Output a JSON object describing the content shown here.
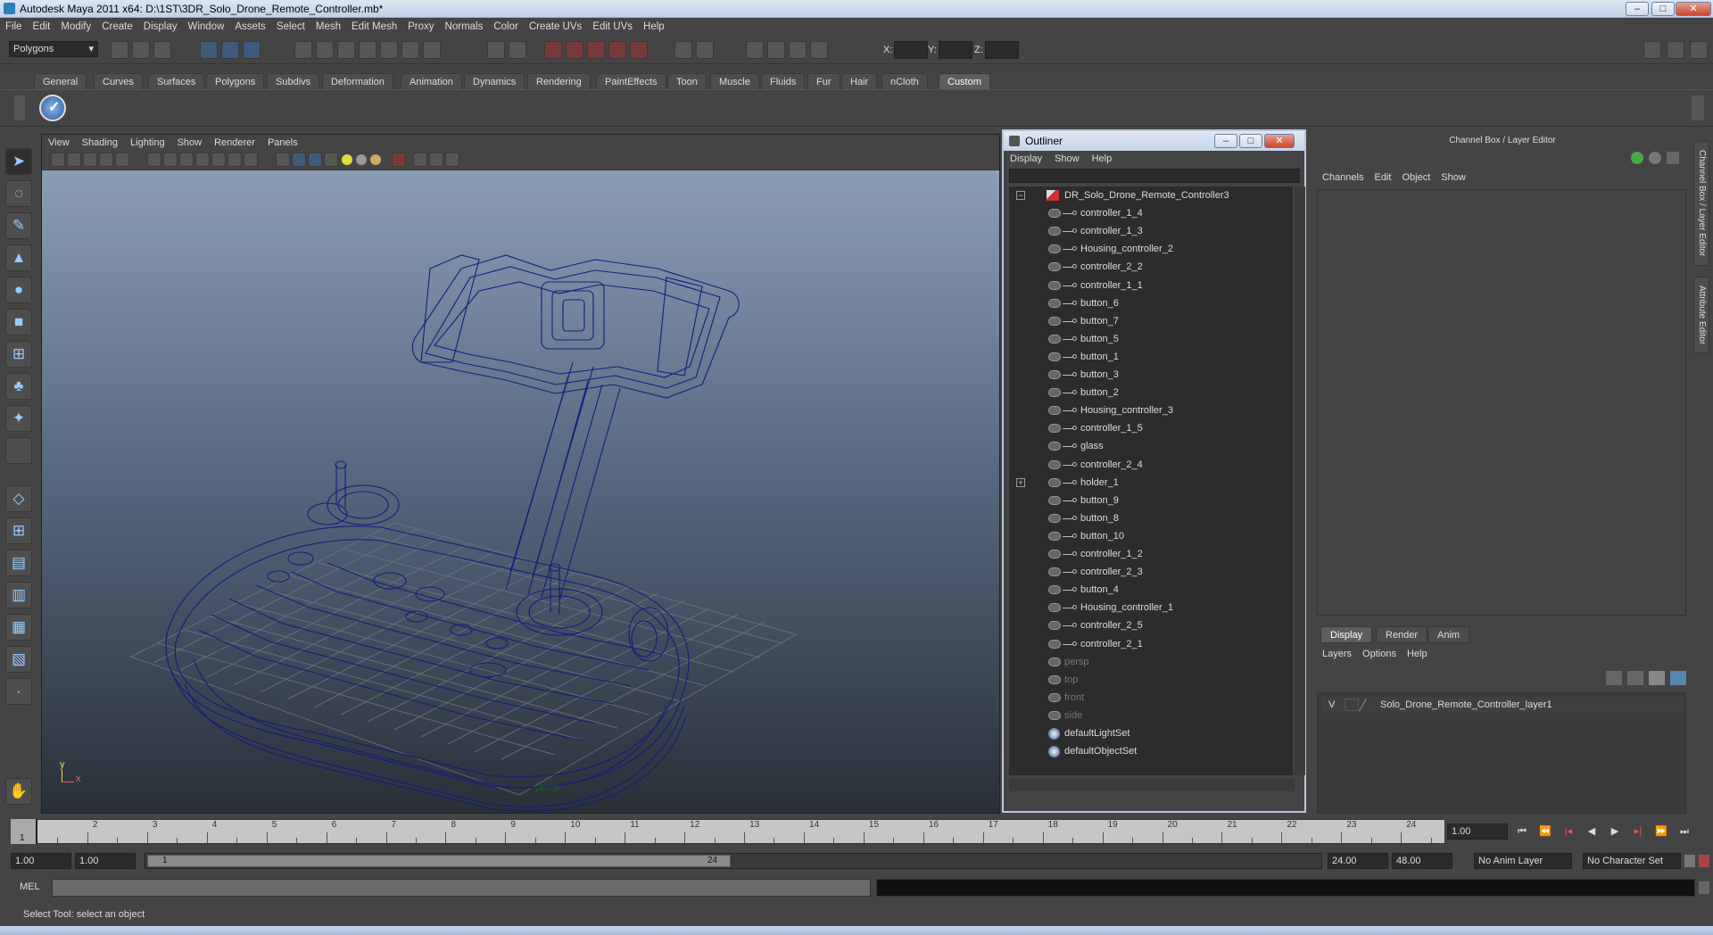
{
  "window": {
    "title": "Autodesk Maya 2011 x64: D:\\1ST\\3DR_Solo_Drone_Remote_Controller.mb*"
  },
  "menubar": [
    "File",
    "Edit",
    "Modify",
    "Create",
    "Display",
    "Window",
    "Assets",
    "Select",
    "Mesh",
    "Edit Mesh",
    "Proxy",
    "Normals",
    "Color",
    "Create UVs",
    "Edit UVs",
    "Help"
  ],
  "status": {
    "mode": "Polygons",
    "x_label": "X:",
    "y_label": "Y:",
    "z_label": "Z:"
  },
  "shelf_tabs": [
    "General",
    "Curves",
    "Surfaces",
    "Polygons",
    "Subdivs",
    "Deformation",
    "Animation",
    "Dynamics",
    "Rendering",
    "PaintEffects",
    "Toon",
    "Muscle",
    "Fluids",
    "Fur",
    "Hair",
    "nCloth",
    "Custom"
  ],
  "shelf_active": "Custom",
  "viewport": {
    "menu": [
      "View",
      "Shading",
      "Lighting",
      "Show",
      "Renderer",
      "Panels"
    ],
    "camera_label": "persp",
    "axis_y": "y",
    "axis_x": "x"
  },
  "outliner": {
    "title": "Outliner",
    "menu": [
      "Display",
      "Show",
      "Help"
    ],
    "root": "DR_Solo_Drone_Remote_Controller3",
    "children": [
      "controller_1_4",
      "controller_1_3",
      "Housing_controller_2",
      "controller_2_2",
      "controller_1_1",
      "button_6",
      "button_7",
      "button_5",
      "button_1",
      "button_3",
      "button_2",
      "Housing_controller_3",
      "controller_1_5",
      "glass",
      "controller_2_4",
      "holder_1",
      "button_9",
      "button_8",
      "button_10",
      "controller_1_2",
      "controller_2_3",
      "button_4",
      "Housing_controller_1",
      "controller_2_5",
      "controller_2_1"
    ],
    "cameras": [
      "persp",
      "top",
      "front",
      "side"
    ],
    "sets": [
      "defaultLightSet",
      "defaultObjectSet"
    ]
  },
  "channel_box": {
    "title": "Channel Box / Layer Editor",
    "menu": [
      "Channels",
      "Edit",
      "Object",
      "Show"
    ],
    "layer_tabs": [
      "Display",
      "Render",
      "Anim"
    ],
    "layer_menu": [
      "Layers",
      "Options",
      "Help"
    ],
    "layer_visible": "V",
    "layer_name": "Solo_Drone_Remote_Controller_layer1",
    "side_tab_1": "Channel Box / Layer Editor",
    "side_tab_2": "Attribute Editor"
  },
  "timeline": {
    "ticks": [
      "1",
      "2",
      "3",
      "4",
      "5",
      "6",
      "7",
      "8",
      "9",
      "10",
      "11",
      "12",
      "13",
      "14",
      "15",
      "16",
      "17",
      "18",
      "19",
      "20",
      "21",
      "22",
      "23",
      "24"
    ],
    "current": "1",
    "current_field": "1.00"
  },
  "range": {
    "start": "1.00",
    "start2": "1.00",
    "slider_start": "1",
    "slider_end": "24",
    "end": "24.00",
    "end2": "48.00",
    "anim_layer": "No Anim Layer",
    "char_set": "No Character Set"
  },
  "cmdline": {
    "label": "MEL"
  },
  "helpline": {
    "text": "Select Tool: select an object"
  }
}
